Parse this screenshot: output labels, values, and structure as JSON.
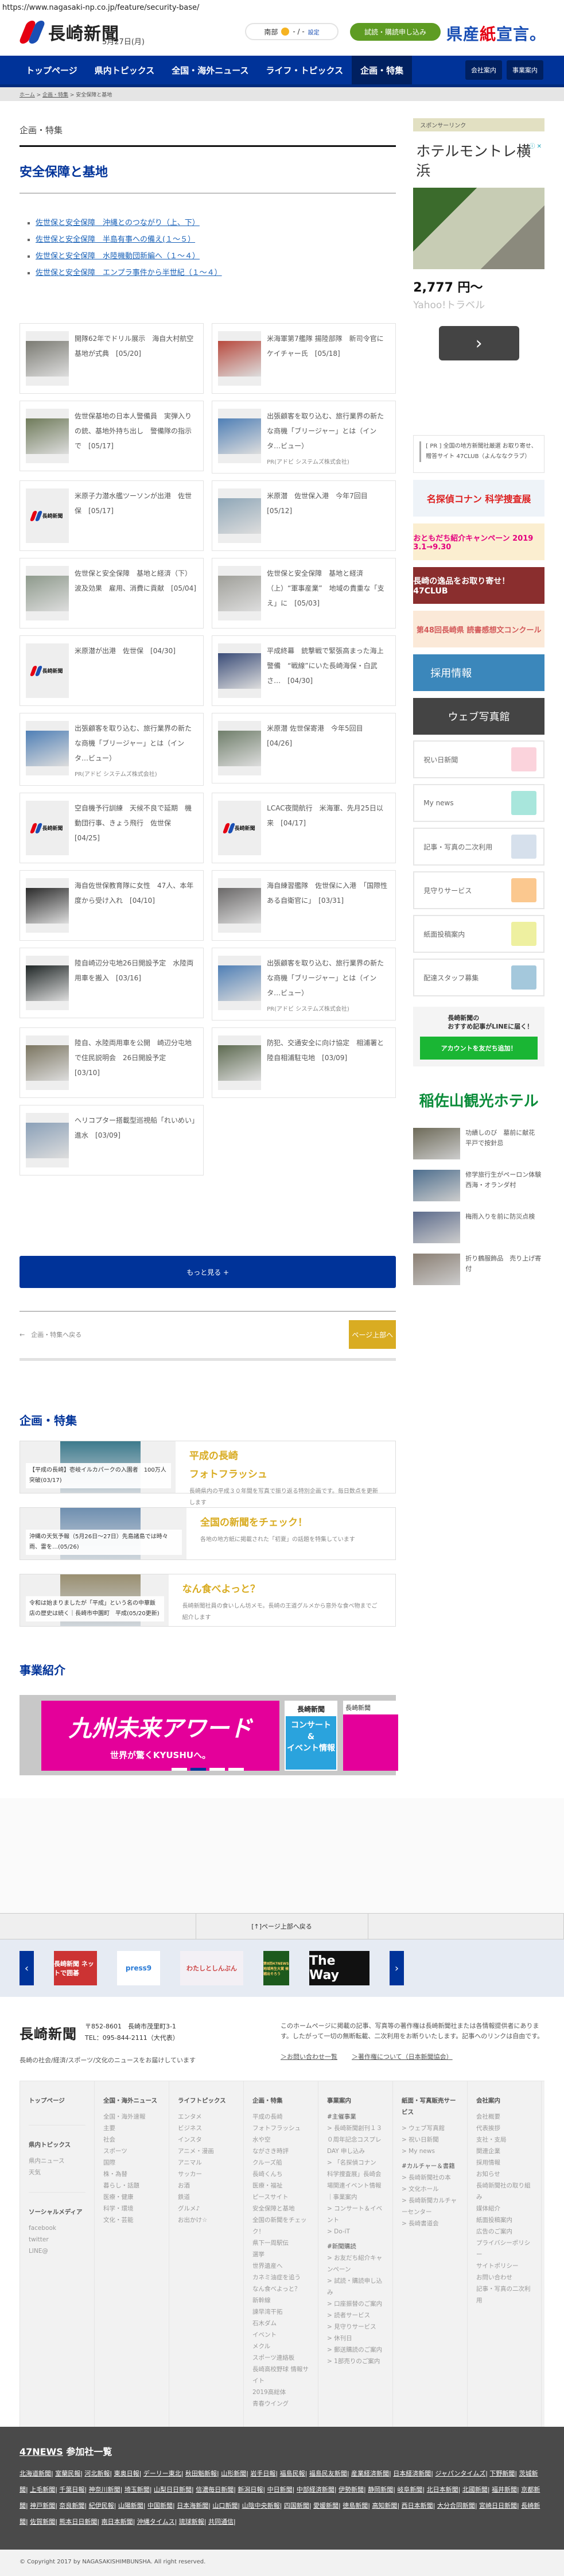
{
  "url": "https://www.nagasaki-np.co.jp/feature/security-base/",
  "header": {
    "logo": "長崎新聞",
    "date": "5月27日(月)",
    "weather_area": "南部",
    "weather_temp": "- / -",
    "weather_setting": "設定",
    "trial_button": "試読・購読申し込み",
    "kensan_a": "県産",
    "kensan_b": "紙",
    "kensan_c": "宣言。"
  },
  "nav": {
    "items": [
      "トップページ",
      "県内トピックス",
      "全国・海外ニュース",
      "ライフ・トピックス",
      "企画・特集"
    ],
    "active": "企画・特集",
    "right": [
      "会社案内",
      "事業案内"
    ]
  },
  "breadcrumb": {
    "home": "ホーム",
    "parent": "企画・特集",
    "current": "安全保障と基地",
    "sep": " > "
  },
  "page": {
    "subtitle": "企画・特集",
    "title": "安全保障と基地",
    "series": [
      "佐世保と安全保障　沖縄とのつながり（上、下）",
      "佐世保と安全保障　半島有事への備え(１～５）",
      "佐世保と安全保障　水陸機動団新編へ（１～４）",
      "佐世保と安全保障　エンプラ事件から半世紀（１～４）"
    ]
  },
  "pr_card": {
    "title": "出張顧客を取り込む、旅行業界の新たな商機「ブリージャー」とは（インタ…ビュー）",
    "sponsor": "PR(アドビ システムズ株式会社)"
  },
  "articles": [
    {
      "title": "開隊62年でドリル展示　海自大村航空基地が式典",
      "date": "[05/20]",
      "img": "#7a7a72"
    },
    {
      "title": "米海軍第7艦隊 揚陸部隊　新司令官にケイチャー氏",
      "date": "[05/18]",
      "img": "#b84a3e"
    },
    {
      "title": "佐世保基地の日本人警備員　実弾入りの銃、基地外持ち出し　警備隊の指示で",
      "date": "[05/17]",
      "img": "#6f7b5a"
    },
    {
      "pr": true,
      "img": "#4f7fb6"
    },
    {
      "title": "米原子力潜水艦ツーソンが出港　佐世保",
      "date": "[05/17]",
      "logo": true
    },
    {
      "title": "米原潜　佐世保入港　今年7回目",
      "date": "[05/12]",
      "img": "#8fa7b8"
    },
    {
      "title": "佐世保と安全保障　基地と経済（下）波及効果　雇用、消費に貢献",
      "date": "[05/04]",
      "img": "#8e9a8c"
    },
    {
      "title": "佐世保と安全保障　基地と経済（上）“軍事産業”　地域の貴重な「支え」に",
      "date": "[05/03]",
      "img": "#a0a09a"
    },
    {
      "title": "米原潜が出港　佐世保",
      "date": "[04/30]",
      "logo": true
    },
    {
      "title": "平成終幕　銃撃戦で緊張高まった海上警備　“戦線”にいた長崎海保・白武さ…",
      "date": "[04/30]",
      "img": "#3a4c78"
    },
    {
      "pr": true,
      "img": "#4f7fb6"
    },
    {
      "title": "米原潜 佐世保寄港　今年5回目",
      "date": "[04/26]",
      "img": "#6f7e6a"
    },
    {
      "title": "空自機予行訓練　天候不良で延期　機動団行事、きょう飛行　佐世保",
      "date": "[04/25]",
      "logo": true
    },
    {
      "title": "LCAC夜間航行　米海軍、先月25日以来",
      "date": "[04/17]",
      "logo": true
    },
    {
      "title": "海自佐世保教育隊に女性　47人、本年度から受け入れ",
      "date": "[04/10]",
      "img": "#2a2a2a"
    },
    {
      "title": "海自練習艦隊　佐世保に入港　「国際性ある自衛官に」",
      "date": "[03/31]",
      "img": "#6a6868"
    },
    {
      "title": "陸自崎辺分屯地26日開設予定　水陸両用車を搬入",
      "date": "[03/16]",
      "img": "#1f2626"
    },
    {
      "pr": true,
      "img": "#4f7fb6"
    },
    {
      "title": "陸自、水陸両用車を公開　崎辺分屯地で住民説明会　26日開設予定",
      "date": "[03/10]",
      "img": "#7b7560"
    },
    {
      "title": "防犯、交通安全に向け協定　相浦署と陸自相浦駐屯地",
      "date": "[03/09]",
      "img": "#5d6a50"
    },
    {
      "title": "ヘリコプター搭載型巡視船「れいめい」進水",
      "date": "[03/09]",
      "img": "#8aa0b8"
    }
  ],
  "more_button": "もっと見る +",
  "back_link": "←　企画・特集へ戻る",
  "page_top_button": "ページ上部へ",
  "features": {
    "heading": "企画・特集",
    "items": [
      {
        "title": "平成の長崎\nフォトフラッシュ",
        "desc": "長崎県内の平成３０年間を写真で振り返る特別企画です。毎日数点を更新します",
        "caption": "【平成の長崎】壱岐イルカパークの入園者　100万人突破(03/17)",
        "img": "#3d7a8c"
      },
      {
        "title": "全国の新聞をチェック！",
        "desc": "各地の地方紙に掲載された「初夏」の話題を特集しています",
        "caption": "沖縄の天気予報（5月26日～27日）先島諸島では時々雨、雷を…(05/26)",
        "img": "#6f8fb0"
      },
      {
        "title": "なん食べよっと？",
        "desc": "長崎新聞社員の食いしん坊メモ。長崎の王道グルメから意外な食べ物までご紹介します",
        "caption": "令和は始まりましたが「平成」という名の中華飯店の歴史は続く｜長崎市中園町　平成(05/20更新)",
        "img": "#9a8f70"
      }
    ]
  },
  "business": {
    "heading": "事業紹介",
    "slide1_a": "九州未来アワード",
    "slide1_b": "世界が驚くKYUSHUへ。",
    "slide2_logo": "長崎新聞",
    "slide2_text": "コンサート\n&\nイベント情報",
    "slide3": "長崎新聞",
    "slides_total": 4,
    "active_slide": 2
  },
  "sidebar": {
    "sponsor_label": "スポンサーリンク",
    "ad": {
      "title": "ホテルモントレ横浜",
      "price": "2,777 円～",
      "source": "Yahoo!トラベル",
      "go": "›"
    },
    "pr_text": "[ PR ] 全国の地方新聞社厳選 お取り寄せ、贈答サイト 47CLUB（よんななクラブ）",
    "banners": [
      "名探偵コナン 科学捜査展",
      "おともだち紹介キャンペーン 2019 3.1→9.30",
      "長崎の逸品をお取り寄せ！ 47CLUB",
      "第48回長崎県 読書感想文コンクール",
      "採用情報",
      "ウェブ写真館"
    ],
    "tiles": [
      {
        "label": "祝い日新聞",
        "color": "#fbd3dc"
      },
      {
        "label": "My news",
        "color": "#a8e6dc"
      },
      {
        "label": "記事・写真の二次利用",
        "color": "#d6e0ec"
      },
      {
        "label": "見守りサービス",
        "color": "#fbc88f"
      },
      {
        "label": "紙面投稿案内",
        "color": "#eef0a0"
      },
      {
        "label": "配達スタッフ募集",
        "color": "#a4c8dc"
      }
    ],
    "line_text": "長崎新聞の\nおすすめ記事がLINEに届く！",
    "line_button": "アカウントを友だち追加！",
    "hotel": "稲佐山観光ホテル",
    "news": [
      {
        "t": "功績しのび　墓前に献花　平戸で按針忌",
        "img": "#6d6a58"
      },
      {
        "t": "修学旅行生がペーロン体験　西海・オランダ村",
        "img": "#4d6e8e"
      },
      {
        "t": "梅雨入りを前に防災点検",
        "img": "#5c6b8c"
      },
      {
        "t": "折り鶴服飾品　売り上げ寄付",
        "img": "#8a7e72"
      }
    ]
  },
  "footer": {
    "page_top": "[↑]ページ上部へ戻る",
    "partner_logos": [
      "長崎新聞 ネットで囲碁",
      "press9",
      "わたしとしんぶん",
      "第8回47NEWS地域再生大賞 候補出そろう",
      "The Way"
    ],
    "address": "〒852-8601　長崎市茂里町3-1",
    "tel": "TEL：095-844-2111（大代表）",
    "tagline": "長崎の社会/経済/スポーツ/文化のニュースをお届けしています",
    "note": "このホームページに掲載の記事、写真等の著作権は長崎新聞社または各情報提供者にあります。したがって一切の無断転載、二次利用をお断りいたします。記事へのリンクは自由です。",
    "links": [
      "＞お問い合わせ一覧",
      "＞著作権について（日本新聞協会）"
    ],
    "sitemap": [
      {
        "blocks": [
          {
            "hd": "トップページ",
            "items": []
          },
          {
            "hd": "県内トピックス",
            "items": [
              "県内ニュース",
              "天気"
            ]
          },
          {
            "hd": "ソーシャルメディア",
            "items": [
              "facebook",
              "twitter",
              "LINE@"
            ]
          }
        ]
      },
      {
        "blocks": [
          {
            "hd": "全国・海外ニュース",
            "items": [
              "全国・海外速報",
              "主要",
              "社会",
              "スポーツ",
              "国際",
              "株・為替",
              "暮らし・話題",
              "医療・健康",
              "科学・環境",
              "文化・芸能"
            ]
          }
        ]
      },
      {
        "blocks": [
          {
            "hd": "ライフトピックス",
            "items": [
              "エンタメ",
              "ビジネス",
              "インスタ",
              "アニメ・漫画",
              "アニマル",
              "サッカー",
              "お酒",
              "鉄道",
              "グルメ♪",
              "お出かけ☆"
            ]
          }
        ]
      },
      {
        "blocks": [
          {
            "hd": "企画・特集",
            "items": [
              "平成の長崎",
              "フォトフラッシュ",
              "水や空",
              "ながさき時評",
              "クルーズ船",
              "長崎くんち",
              "医療・福祉",
              "ピースサイト",
              "安全保障と基地",
              "全国の新聞をチェック！",
              "県下一周駅伝",
              "選挙",
              "世界遺産へ",
              "カネミ油症を追う",
              "なん食べよっと？",
              "新幹線",
              "諫早湾干拓",
              "石木ダム",
              "イベント",
              "メクル",
              "スポーツ連絡板",
              "長崎高校野球 情報サイト",
              "2019高総体",
              "青春ウイング"
            ]
          }
        ]
      },
      {
        "blocks": [
          {
            "hd": "事業案内",
            "items": [
              "#主催事業",
              "> 長崎新聞創刊１３０周年記念コスプレDAY 申し込み",
              "> 「名探偵コナン 科学捜査展」長崎会場関連イベント情報｜事業案内",
              "> コンサート＆イベント",
              "> Do-iT",
              "#新聞購読",
              "> お友だち紹介キャンペーン",
              "> 試読・購読申し込み",
              "> 口座振替のご案内",
              "> 読者サービス",
              "> 見守りサービス",
              "> 休刊日",
              "> 郵送購読のご案内",
              "> 1部売りのご案内"
            ]
          }
        ]
      },
      {
        "blocks": [
          {
            "hd": "紙面・写真販売サービス",
            "items": [
              "> ウェブ写真館",
              "> 祝い日新聞",
              "> My news",
              "#カルチャー＆書籍",
              "> 長崎新聞社の本",
              "> 文化ホール",
              "> 長崎新聞カルチャーセンター",
              "> 長崎書道会"
            ]
          }
        ]
      },
      {
        "blocks": [
          {
            "hd": "会社案内",
            "items": [
              "会社概要",
              "代表挨拶",
              "支社・支局",
              "関連企業",
              "採用情報",
              "お知らせ",
              "長崎新聞社の取り組み",
              "媒体紹介",
              "紙面投稿案内",
              "広告のご案内",
              "プライバシーポリシー",
              "サイトポリシー",
              "お問い合わせ",
              "記事・写真の二次利用"
            ]
          }
        ]
      }
    ],
    "news47_link": "47NEWS",
    "news47_rest": " 参加社一覧",
    "papers": [
      "北海道新聞",
      "室蘭民報",
      "河北新報",
      "東奥日報",
      "デーリー東北",
      "秋田魁新報",
      "山形新聞",
      "岩手日報",
      "福島民報",
      "福島民友新聞",
      "産業経済新聞",
      "日本経済新聞",
      "ジャパンタイムズ",
      "下野新聞",
      "茨城新聞",
      "上毛新聞",
      "千葉日報",
      "神奈川新聞",
      "埼玉新聞",
      "山梨日日新聞",
      "信濃毎日新聞",
      "新潟日報",
      "中日新聞",
      "中部経済新聞",
      "伊勢新聞",
      "静岡新聞",
      "岐阜新聞",
      "北日本新聞",
      "北國新聞",
      "福井新聞",
      "京都新聞",
      "神戸新聞",
      "奈良新聞",
      "紀伊民報",
      "山陽新聞",
      "中国新聞",
      "日本海新聞",
      "山口新聞",
      "山陰中央新報",
      "四国新聞",
      "愛媛新聞",
      "徳島新聞",
      "高知新聞",
      "西日本新聞",
      "大分合同新聞",
      "宮崎日日新聞",
      "長崎新聞",
      "佐賀新聞",
      "熊本日日新聞",
      "南日本新聞",
      "沖縄タイムス",
      "琉球新報",
      "共同通信"
    ],
    "copyright": "© Copyright 2017 by NAGASAKISHIMBUNSHA. All right reserved."
  },
  "colors": {
    "brand_blue": "#003399",
    "gold": "#d9ac22",
    "line_green": "#1ab634"
  }
}
